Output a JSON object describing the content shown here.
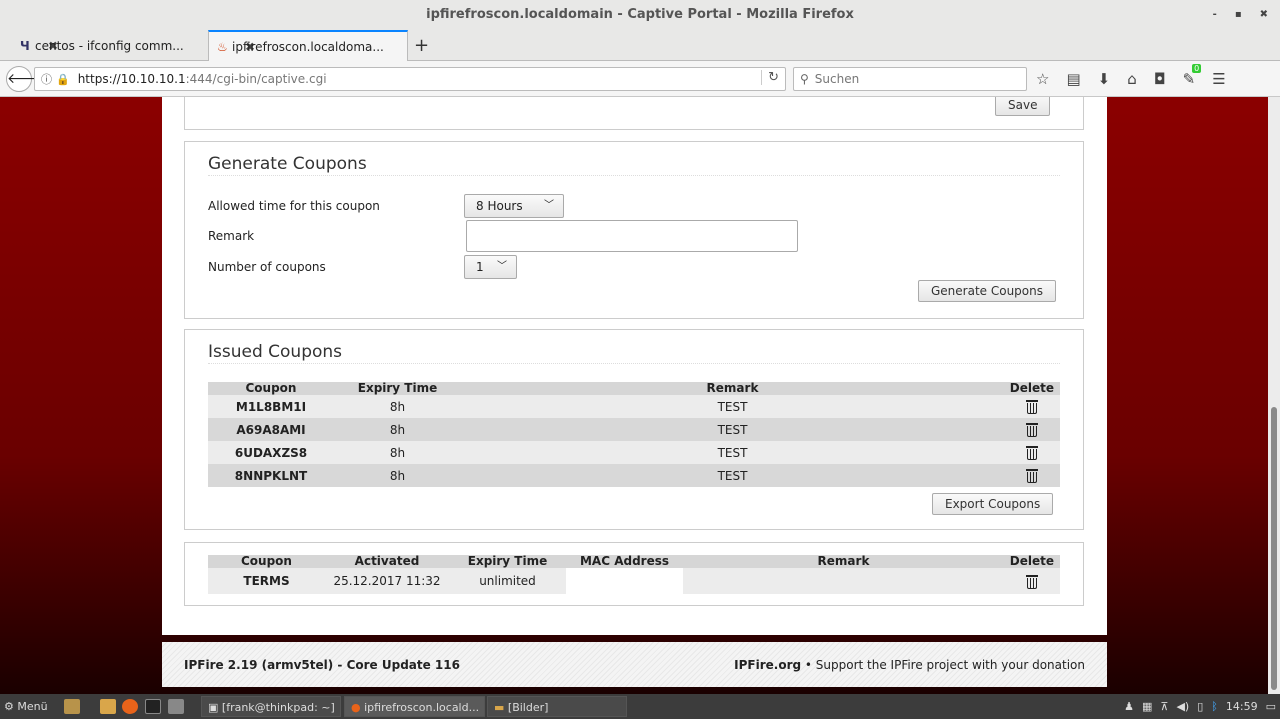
{
  "window": {
    "title": "ipfirefroscon.localdomain - Captive Portal - Mozilla Firefox",
    "ctrl_min": "-",
    "ctrl_max": "▪",
    "ctrl_close": "✖"
  },
  "tabs": [
    {
      "label": "centos - ifconfig comm...",
      "close": "✖"
    },
    {
      "label": "ipfirefroscon.localdoma...",
      "close": "✖"
    }
  ],
  "newtab": "+",
  "url": {
    "host": "https://10.10.10.1",
    "rest": ":444/cgi-bin/captive.cgi"
  },
  "search": {
    "placeholder": "Suchen"
  },
  "addon_badge": "0",
  "save_label": "Save",
  "generate": {
    "title": "Generate Coupons",
    "allowed_label": "Allowed time for this coupon",
    "allowed_value": "8 Hours",
    "remark_label": "Remark",
    "remark_value": "",
    "number_label": "Number of coupons",
    "number_value": "1",
    "button": "Generate Coupons"
  },
  "issued": {
    "title": "Issued Coupons",
    "headers": [
      "Coupon",
      "Expiry Time",
      "Remark",
      "Delete"
    ],
    "rows": [
      {
        "coupon": "M1L8BM1I",
        "expiry": "8h",
        "remark": "TEST"
      },
      {
        "coupon": "A69A8AMI",
        "expiry": "8h",
        "remark": "TEST"
      },
      {
        "coupon": "6UDAXZS8",
        "expiry": "8h",
        "remark": "TEST"
      },
      {
        "coupon": "8NNPKLNT",
        "expiry": "8h",
        "remark": "TEST"
      }
    ],
    "export_button": "Export Coupons"
  },
  "active": {
    "headers": [
      "Coupon",
      "Activated",
      "Expiry Time",
      "MAC Address",
      "Remark",
      "Delete"
    ],
    "rows": [
      {
        "coupon": "TERMS",
        "activated": "25.12.2017 11:32",
        "expiry": "unlimited",
        "mac": "",
        "remark": ""
      }
    ]
  },
  "footer": {
    "left": "IPFire 2.19 (armv5tel) - Core Update 116",
    "right_brand": "IPFire.org",
    "right_text": " • Support the IPFire project with your donation"
  },
  "taskbar": {
    "menu": "Menü",
    "tasks": [
      "[frank@thinkpad: ~]",
      "ipfirefroscon.locald...",
      "[Bilder]"
    ],
    "clock": "14:59"
  }
}
